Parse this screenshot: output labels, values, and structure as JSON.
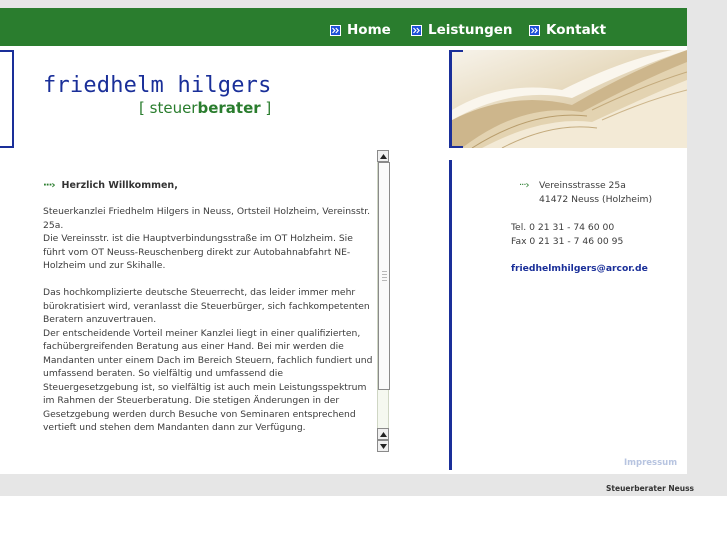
{
  "nav": {
    "items": [
      {
        "label": "Home"
      },
      {
        "label": "Leistungen"
      },
      {
        "label": "Kontakt"
      }
    ]
  },
  "logo": {
    "name": "friedhelm hilgers",
    "sub_open": "[",
    "sub_light": "steuer",
    "sub_strong": "berater",
    "sub_close": "]"
  },
  "main": {
    "welcome": "Herzlich Willkommen,",
    "paragraphs": [
      "Steuerkanzlei Friedhelm Hilgers in Neuss, Ortsteil Holzheim, Vereinsstr. 25a.\nDie Vereinsstr. ist die Hauptverbindungsstraße im OT Holzheim. Sie führt vom OT Neuss-Reuschenberg direkt zur Autobahnabfahrt NE-Holzheim und zur Skihalle.",
      "Das hochkomplizierte deutsche Steuerrecht, das leider immer mehr bürokratisiert wird, veranlasst die Steuerbürger, sich fachkompetenten Beratern anzuvertrauen.\nDer entscheidende Vorteil meiner Kanzlei liegt in einer qualifizierten, fachübergreifenden Beratung aus einer Hand. Bei mir werden die Mandanten unter einem Dach im Bereich Steuern, fachlich fundiert und umfassend beraten. So vielfältig und umfassend die Steuergesetzgebung ist, so vielfältig ist auch mein Leistungsspektrum im Rahmen der Steuerberatung. Die stetigen Änderungen in der Gesetzgebung werden durch Besuche von Seminaren entsprechend vertieft und stehen dem Mandanten dann zur Verfügung."
    ]
  },
  "contact": {
    "street": "Vereinsstrasse 25a",
    "city": "41472 Neuss (Holzheim)",
    "tel": "Tel. 0 21 31 - 74 60 00",
    "fax": "Fax 0 21 31 - 7 46 00 95",
    "email": "friedhelmhilgers@arcor.de"
  },
  "footer": {
    "impressum": "Impressum",
    "note": "Steuerberater Neuss"
  },
  "colors": {
    "nav_green": "#2a7d2e",
    "brand_blue": "#1a2f99",
    "nav_icon_blue": "#1e4fd8"
  }
}
